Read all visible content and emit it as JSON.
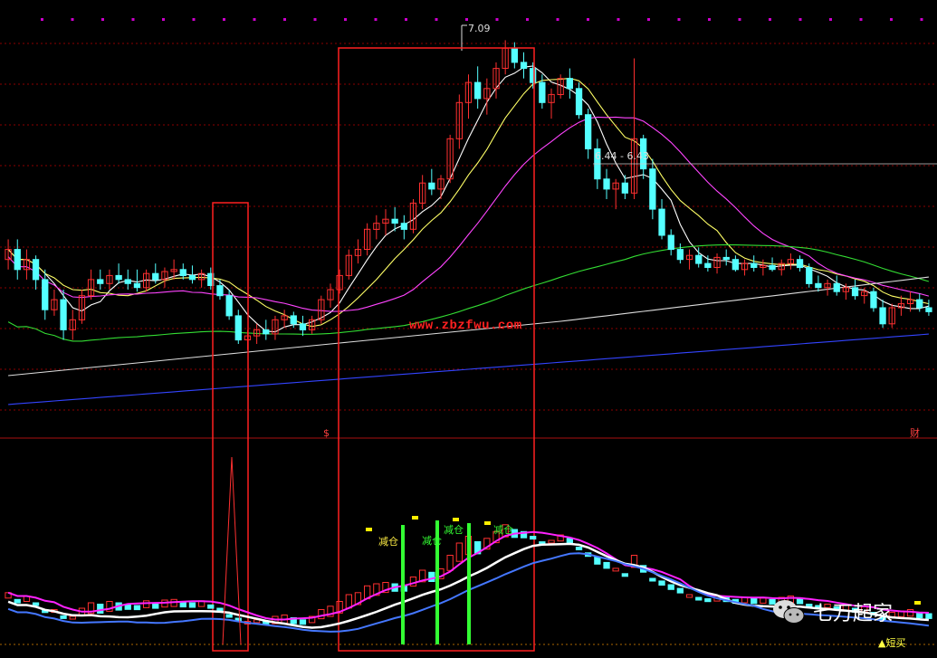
{
  "chart_data": {
    "type": "candlestick",
    "price_panel": {
      "high_label": "7.09",
      "range_label": "6.44 - 6.43",
      "right_marker": "财",
      "dollar_marker": "$",
      "ohlc": [
        [
          6.0,
          6.1,
          5.95,
          6.05
        ],
        [
          6.05,
          6.1,
          5.9,
          5.95
        ],
        [
          5.95,
          6.05,
          5.9,
          6.0
        ],
        [
          6.0,
          6.02,
          5.85,
          5.9
        ],
        [
          5.9,
          5.95,
          5.7,
          5.75
        ],
        [
          5.75,
          5.85,
          5.72,
          5.8
        ],
        [
          5.8,
          5.85,
          5.6,
          5.65
        ],
        [
          5.65,
          5.75,
          5.6,
          5.7
        ],
        [
          5.7,
          5.85,
          5.68,
          5.82
        ],
        [
          5.82,
          5.95,
          5.8,
          5.9
        ],
        [
          5.9,
          5.95,
          5.85,
          5.88
        ],
        [
          5.88,
          5.95,
          5.85,
          5.92
        ],
        [
          5.92,
          5.98,
          5.88,
          5.9
        ],
        [
          5.9,
          5.95,
          5.85,
          5.88
        ],
        [
          5.88,
          5.95,
          5.84,
          5.86
        ],
        [
          5.86,
          5.95,
          5.84,
          5.93
        ],
        [
          5.93,
          5.98,
          5.88,
          5.9
        ],
        [
          5.9,
          5.96,
          5.86,
          5.94
        ],
        [
          5.94,
          6.0,
          5.9,
          5.95
        ],
        [
          5.95,
          5.98,
          5.9,
          5.92
        ],
        [
          5.92,
          5.97,
          5.88,
          5.9
        ],
        [
          5.9,
          5.95,
          5.86,
          5.93
        ],
        [
          5.93,
          5.96,
          5.85,
          5.87
        ],
        [
          5.87,
          5.9,
          5.8,
          5.82
        ],
        [
          5.82,
          5.85,
          5.7,
          5.72
        ],
        [
          5.72,
          5.75,
          5.58,
          5.6
        ],
        [
          5.6,
          5.65,
          5.55,
          5.62
        ],
        [
          5.62,
          5.68,
          5.58,
          5.65
        ],
        [
          5.65,
          5.7,
          5.6,
          5.63
        ],
        [
          5.63,
          5.72,
          5.6,
          5.7
        ],
        [
          5.7,
          5.75,
          5.66,
          5.72
        ],
        [
          5.72,
          5.74,
          5.66,
          5.68
        ],
        [
          5.68,
          5.72,
          5.62,
          5.65
        ],
        [
          5.65,
          5.72,
          5.63,
          5.7
        ],
        [
          5.7,
          5.82,
          5.68,
          5.8
        ],
        [
          5.8,
          5.88,
          5.76,
          5.85
        ],
        [
          5.85,
          5.95,
          5.83,
          5.92
        ],
        [
          5.92,
          6.05,
          5.9,
          6.02
        ],
        [
          6.02,
          6.1,
          5.98,
          6.05
        ],
        [
          6.05,
          6.18,
          6.02,
          6.15
        ],
        [
          6.15,
          6.22,
          6.1,
          6.18
        ],
        [
          6.18,
          6.25,
          6.12,
          6.2
        ],
        [
          6.2,
          6.26,
          6.14,
          6.18
        ],
        [
          6.18,
          6.22,
          6.1,
          6.15
        ],
        [
          6.15,
          6.3,
          6.13,
          6.28
        ],
        [
          6.28,
          6.42,
          6.25,
          6.38
        ],
        [
          6.38,
          6.45,
          6.32,
          6.35
        ],
        [
          6.35,
          6.42,
          6.3,
          6.4
        ],
        [
          6.4,
          6.62,
          6.38,
          6.6
        ],
        [
          6.6,
          6.82,
          6.55,
          6.78
        ],
        [
          6.78,
          6.92,
          6.7,
          6.88
        ],
        [
          6.88,
          6.96,
          6.75,
          6.8
        ],
        [
          6.8,
          6.9,
          6.72,
          6.85
        ],
        [
          6.85,
          6.98,
          6.8,
          6.95
        ],
        [
          6.95,
          7.09,
          6.92,
          7.05
        ],
        [
          7.05,
          7.08,
          6.95,
          6.98
        ],
        [
          6.98,
          7.03,
          6.9,
          6.95
        ],
        [
          6.95,
          6.98,
          6.85,
          6.88
        ],
        [
          6.88,
          6.92,
          6.75,
          6.78
        ],
        [
          6.78,
          6.85,
          6.7,
          6.82
        ],
        [
          6.82,
          6.92,
          6.8,
          6.9
        ],
        [
          6.9,
          6.95,
          6.8,
          6.85
        ],
        [
          6.85,
          6.88,
          6.7,
          6.72
        ],
        [
          6.72,
          6.75,
          6.5,
          6.55
        ],
        [
          6.55,
          6.6,
          6.35,
          6.4
        ],
        [
          6.4,
          6.45,
          6.3,
          6.35
        ],
        [
          6.35,
          6.4,
          6.25,
          6.38
        ],
        [
          6.38,
          6.42,
          6.3,
          6.33
        ],
        [
          6.33,
          7.0,
          6.3,
          6.6
        ],
        [
          6.6,
          6.62,
          6.4,
          6.45
        ],
        [
          6.45,
          6.5,
          6.2,
          6.25
        ],
        [
          6.25,
          6.3,
          6.1,
          6.12
        ],
        [
          6.12,
          6.15,
          6.02,
          6.05
        ],
        [
          6.05,
          6.08,
          5.98,
          6.0
        ],
        [
          6.0,
          6.05,
          5.95,
          6.02
        ],
        [
          6.02,
          6.06,
          5.96,
          5.98
        ],
        [
          5.98,
          6.02,
          5.94,
          5.96
        ],
        [
          5.96,
          6.03,
          5.93,
          6.01
        ],
        [
          6.01,
          6.05,
          5.97,
          6.0
        ],
        [
          6.0,
          6.02,
          5.94,
          5.95
        ],
        [
          5.95,
          6.0,
          5.92,
          5.98
        ],
        [
          5.98,
          6.02,
          5.94,
          5.96
        ],
        [
          5.96,
          6.0,
          5.92,
          5.97
        ],
        [
          5.97,
          6.01,
          5.94,
          5.95
        ],
        [
          5.95,
          6.0,
          5.92,
          5.98
        ],
        [
          5.98,
          6.03,
          5.95,
          6.0
        ],
        [
          6.0,
          6.02,
          5.94,
          5.96
        ],
        [
          5.96,
          5.98,
          5.86,
          5.88
        ],
        [
          5.88,
          5.92,
          5.84,
          5.86
        ],
        [
          5.86,
          5.9,
          5.82,
          5.88
        ],
        [
          5.88,
          5.92,
          5.82,
          5.84
        ],
        [
          5.84,
          5.88,
          5.8,
          5.86
        ],
        [
          5.86,
          5.9,
          5.8,
          5.82
        ],
        [
          5.82,
          5.86,
          5.78,
          5.84
        ],
        [
          5.84,
          5.86,
          5.74,
          5.76
        ],
        [
          5.76,
          5.8,
          5.66,
          5.68
        ],
        [
          5.68,
          5.78,
          5.66,
          5.76
        ],
        [
          5.76,
          5.82,
          5.72,
          5.78
        ],
        [
          5.78,
          5.84,
          5.74,
          5.8
        ],
        [
          5.8,
          5.83,
          5.74,
          5.76
        ],
        [
          5.76,
          5.8,
          5.72,
          5.74
        ]
      ]
    },
    "indicator_panel": {
      "signal_labels": [
        "减仓",
        "减仓",
        "减仓",
        "减仓"
      ],
      "buy_label": "▲短买"
    },
    "boxes": 2
  },
  "brand": {
    "text": "七万起家"
  },
  "watermark": "www.zbzfwu.com",
  "colors": {
    "up": "#ff3030",
    "down": "#54ffff",
    "box": "#ff2020",
    "grid": "#8b0000",
    "ma5": "#ffffff",
    "ma10": "#ffff66",
    "ma20": "#ff44ff",
    "ma60": "#33dd33",
    "ma120": "#dddddd",
    "ma250": "#3344ff",
    "ind_white": "#ffffff",
    "ind_magenta": "#ff22ff",
    "ind_blue": "#4477ff",
    "signal": "#33ff33",
    "dot": "#cc00cc"
  }
}
